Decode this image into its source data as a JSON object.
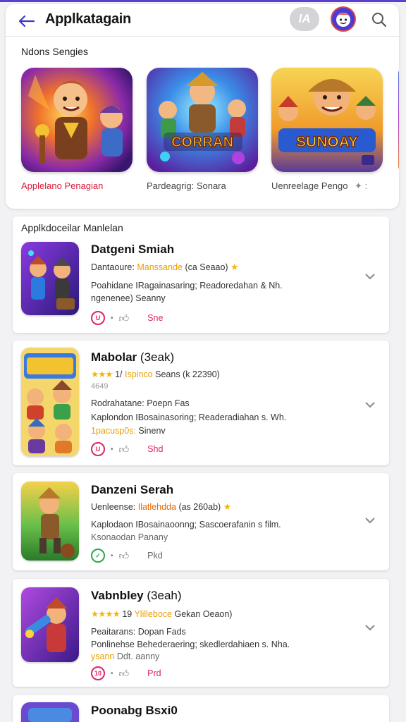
{
  "app": {
    "title": "Applkatagain",
    "chip_label": "lA"
  },
  "featured": {
    "heading": "Ndons Sengies",
    "items": [
      {
        "caption": "Applelano Penagian",
        "caption_color": "#d81b3c",
        "art_text": ""
      },
      {
        "caption": "Pardeagrig: Sonara",
        "caption_color": "#444444",
        "art_text": "CORRAN"
      },
      {
        "caption": "Uenreelage Pengo",
        "caption_color": "#444444",
        "art_text": "SUNOAY",
        "extra": "✦ :"
      }
    ]
  },
  "list": {
    "heading": "Applkdoceilar Manlelan",
    "apps": [
      {
        "name": "Datgeni Smiah",
        "line1_prefix": "Dantaoure:",
        "line1_highlight": "Manssande",
        "line1_suffix": "(ca Seaao)",
        "line2": "Poahidane IRagainasaring; Readoredahan & Nh.",
        "line3": "ngenenee) Seanny",
        "badge": "U",
        "action": "Sne"
      },
      {
        "name": "Mabolar",
        "name_suffix": "(3eak)",
        "rating_stars": "★★★",
        "rating_count": "1/",
        "rating_highlight": "Ispinco",
        "rating_suffix": "Seans (k 22390)",
        "sub_line": "4649",
        "line1": "Rodrahatane: Poepn Fas",
        "line2": "Kaplondon IBosainasoring; Readeradiahan s. Wh.",
        "line3_highlight": "1pacusp0s:",
        "line3": "Sinenv",
        "badge": "U",
        "action": "Shd"
      },
      {
        "name": "Danzeni Serah",
        "line1_prefix": "Uenleense:",
        "line1_highlight": "Ilatlehdda",
        "line1_suffix": "(as 260ab)",
        "line2": "Kaplodaon IBosainaoonng; Sascoerafanin s film.",
        "line3": "Ksonaodan Panany",
        "badge": "✓",
        "action": "Pkd"
      },
      {
        "name": "Vabnbley",
        "name_suffix": "(3eah)",
        "rating_stars": "★★★★",
        "rating_count": "19",
        "rating_highlight": "Ylilleboce",
        "rating_suffix": "Gekan Oeaon)",
        "line1": "Peaitarans: Dopan Fads",
        "line2": "Ponlinehse Behederaering; skedlerdahiaen s. Nha.",
        "line3_highlight": "ysann",
        "line3": "Ddt. aanny",
        "badge": "10",
        "action": "Prd"
      },
      {
        "name": "Poonabg Bsxi0"
      }
    ]
  },
  "colors": {
    "accent": "#5b3fd1",
    "pink": "#e0226b",
    "gold": "#f4b400"
  }
}
